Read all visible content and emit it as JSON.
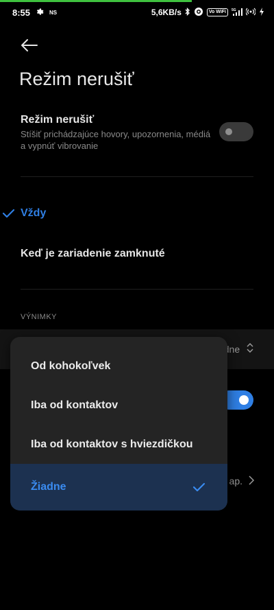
{
  "status_bar": {
    "time": "8:55",
    "carrier_badge": "NS",
    "net_speed": "5,6KB/s",
    "vowifi_label": "Vo WiFi",
    "network_type": "5G"
  },
  "header": {
    "title": "Režim nerušiť"
  },
  "dnd_setting": {
    "title": "Režim nerušiť",
    "description": "Stíšiť prichádzajúce hovory, upozornenia, médiá a vypnúť vibrovanie",
    "enabled": false
  },
  "options": {
    "always_label": "Vždy",
    "locked_label": "Keď je zariadenie zamknuté",
    "selected": "always"
  },
  "exceptions": {
    "section_label": "VÝNIMKY",
    "value_partial": "dne",
    "second_toggle_enabled": true,
    "partial_value2": "ap."
  },
  "popup": {
    "items": [
      {
        "label": "Od kohokoľvek"
      },
      {
        "label": "Iba od kontaktov"
      },
      {
        "label": "Iba od kontaktov s hviezdičkou"
      },
      {
        "label": "Žiadne"
      }
    ],
    "selected_index": 3
  },
  "colors": {
    "accent": "#2f7fe4",
    "progress": "#3fc13f"
  }
}
